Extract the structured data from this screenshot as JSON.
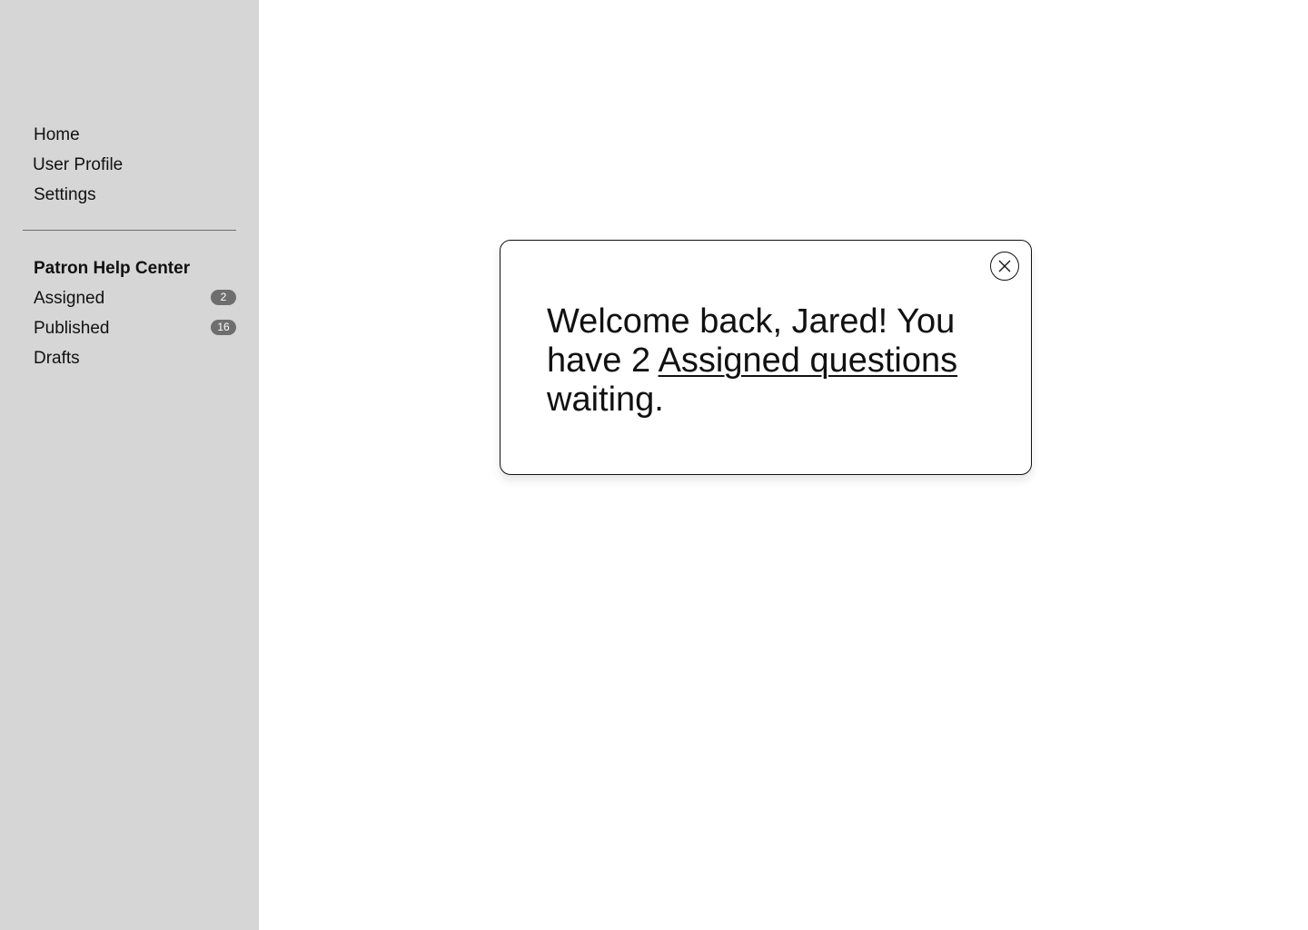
{
  "sidebar": {
    "nav": [
      {
        "label": "Home"
      },
      {
        "label": "User Profile"
      },
      {
        "label": "Settings"
      }
    ],
    "help_center": {
      "title": "Patron Help Center",
      "items": [
        {
          "label": "Assigned",
          "badge": "2"
        },
        {
          "label": "Published",
          "badge": "16"
        },
        {
          "label": "Drafts"
        }
      ]
    }
  },
  "dialog": {
    "message_before": "Welcome back, Jared! You have 2 ",
    "message_link": "Assigned questions",
    "message_after": " waiting.",
    "close_icon": "close-icon"
  },
  "colors": {
    "sidebar_bg": "#d6d6d6",
    "badge_bg": "#6e6e6e",
    "text": "#111111"
  }
}
